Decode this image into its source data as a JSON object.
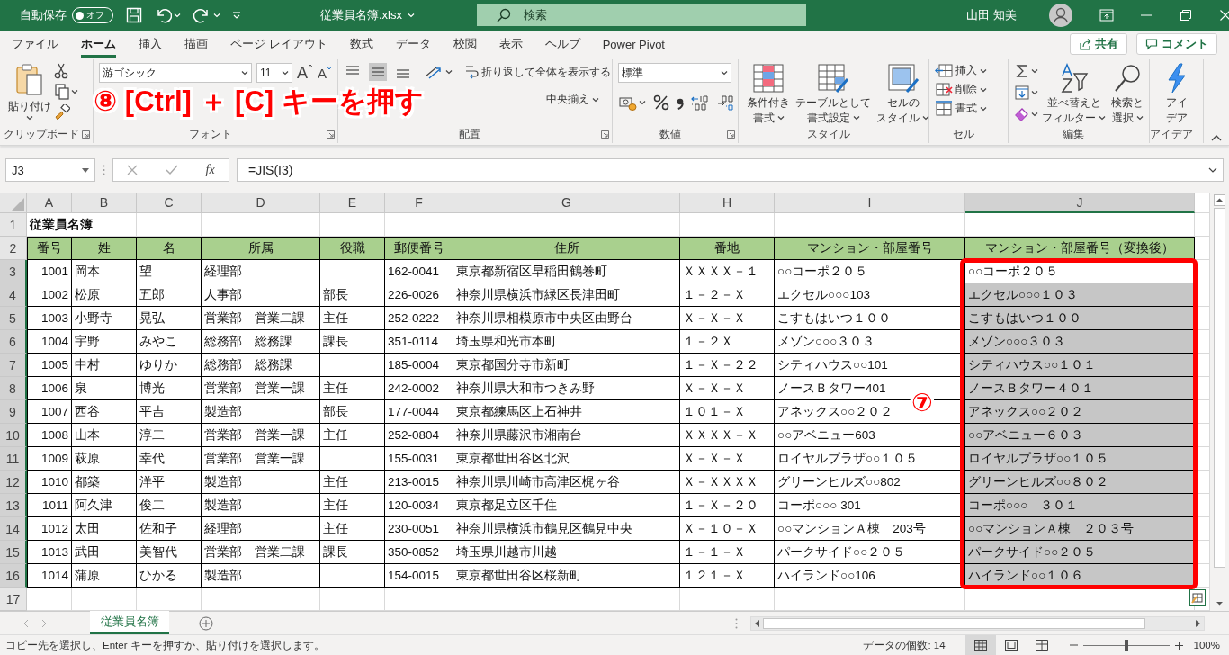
{
  "title_bar": {
    "autosave_label": "自動保存",
    "autosave_toggle": {
      "label": "オフ",
      "on": false
    },
    "file_name": "従業員名簿.xlsx",
    "search_placeholder": "検索",
    "user_name": "山田 知美"
  },
  "menu_tabs": [
    {
      "label": "ファイル",
      "selected": false
    },
    {
      "label": "ホーム",
      "selected": true
    },
    {
      "label": "挿入",
      "selected": false
    },
    {
      "label": "描画",
      "selected": false
    },
    {
      "label": "ページ レイアウト",
      "selected": false
    },
    {
      "label": "数式",
      "selected": false
    },
    {
      "label": "データ",
      "selected": false
    },
    {
      "label": "校閲",
      "selected": false
    },
    {
      "label": "表示",
      "selected": false
    },
    {
      "label": "ヘルプ",
      "selected": false
    },
    {
      "label": "Power Pivot",
      "selected": false
    }
  ],
  "actions": [
    {
      "label": "共有",
      "kind": "share"
    },
    {
      "label": "コメント",
      "kind": "comment"
    }
  ],
  "ribbon": {
    "clipboard": {
      "paste": "貼り付け",
      "label": "クリップボード"
    },
    "font": {
      "font_name": "游ゴシック",
      "font_size": "11",
      "grow": "A",
      "shrink": "A",
      "label": "フォント"
    },
    "alignment": {
      "wrap_text": "折り返して全体を表示する",
      "merge_center": "中央揃え",
      "label": "配置"
    },
    "number": {
      "format": "標準",
      "label": "数値"
    },
    "styles": {
      "buttons": [
        {
          "lines": [
            "条件付き",
            "書式"
          ],
          "kind": "conditional"
        },
        {
          "lines": [
            "テーブルとして",
            "書式設定"
          ],
          "kind": "table"
        },
        {
          "lines": [
            "セルの",
            "スタイル"
          ],
          "kind": "cellstyle"
        }
      ],
      "label": "スタイル"
    },
    "cells": {
      "buttons": [
        {
          "label": "挿入",
          "kind": "insert"
        },
        {
          "label": "削除",
          "kind": "delete"
        },
        {
          "label": "書式",
          "kind": "format"
        }
      ],
      "label": "セル"
    },
    "editing": {
      "buttons": [
        {
          "lines": [
            "並べ替えと",
            "フィルター"
          ],
          "kind": "sort"
        },
        {
          "lines": [
            "検索と",
            "選択"
          ],
          "kind": "find"
        }
      ],
      "label": "編集"
    },
    "ideas": {
      "lines": [
        "アイ",
        "デア"
      ],
      "label": "アイデア"
    }
  },
  "formula_bar": {
    "name_box": "J3",
    "function_label": "fx",
    "formula": "=JIS(I3)"
  },
  "sheet": {
    "columns": [
      {
        "letter": "A",
        "selected": false
      },
      {
        "letter": "B",
        "selected": false
      },
      {
        "letter": "C",
        "selected": false
      },
      {
        "letter": "D",
        "selected": false
      },
      {
        "letter": "E",
        "selected": false
      },
      {
        "letter": "F",
        "selected": false
      },
      {
        "letter": "G",
        "selected": false
      },
      {
        "letter": "H",
        "selected": false
      },
      {
        "letter": "I",
        "selected": false
      },
      {
        "letter": "J",
        "selected": true
      }
    ],
    "row_numbers": [
      "1",
      "2",
      "3",
      "4",
      "5",
      "6",
      "7",
      "8",
      "9",
      "10",
      "11",
      "12",
      "13",
      "14",
      "15",
      "16",
      "17"
    ],
    "title": "従業員名簿",
    "headers": [
      "番号",
      "姓",
      "名",
      "所属",
      "役職",
      "郵便番号",
      "住所",
      "番地",
      "マンション・部屋番号",
      "マンション・部屋番号（変換後）"
    ],
    "rows": [
      {
        "number": "1001",
        "last_name": "岡本",
        "first_name": "望",
        "department": "経理部",
        "postal_code": "162-0041",
        "address": "東京都新宿区早稲田鶴巻町",
        "block": "ＸＸＸＸ－１",
        "building": "○○コーポ２０５",
        "building_converted": "○○コーポ２０５",
        "selected": true,
        "active": true
      },
      {
        "number": "1002",
        "last_name": "松原",
        "first_name": "五郎",
        "department": "人事部",
        "position": "部長",
        "postal_code": "226-0026",
        "address": "神奈川県横浜市緑区長津田町",
        "block": "１－２－Ｘ",
        "building": "エクセル○○○103",
        "building_converted": "エクセル○○○１０３",
        "selected": true,
        "active": false
      },
      {
        "number": "1003",
        "last_name": "小野寺",
        "first_name": "晃弘",
        "department": "営業部　営業二課",
        "position": "主任",
        "postal_code": "252-0222",
        "address": "神奈川県相模原市中央区由野台",
        "block": "Ｘ－Ｘ－Ｘ",
        "building": "こすもはいつ１００",
        "building_converted": "こすもはいつ１００",
        "selected": true,
        "active": false
      },
      {
        "number": "1004",
        "last_name": "宇野",
        "first_name": "みやこ",
        "department": "総務部　総務課",
        "position": "課長",
        "postal_code": "351-0114",
        "address": "埼玉県和光市本町",
        "block": "１－２Ｘ",
        "building": "メゾン○○○３０３",
        "building_converted": "メゾン○○○３０３",
        "selected": true,
        "active": false
      },
      {
        "number": "1005",
        "last_name": "中村",
        "first_name": "ゆりか",
        "department": "総務部　総務課",
        "postal_code": "185-0004",
        "address": "東京都国分寺市新町",
        "block": "１－Ｘ－２２",
        "building": "シティハウス○○101",
        "building_converted": "シティハウス○○１０１",
        "selected": true,
        "active": false
      },
      {
        "number": "1006",
        "last_name": "泉",
        "first_name": "博光",
        "department": "営業部　営業一課",
        "position": "主任",
        "postal_code": "242-0002",
        "address": "神奈川県大和市つきみ野",
        "block": "Ｘ－Ｘ－Ｘ",
        "building": "ノースＢタワー401",
        "building_converted": "ノースＢタワー４０１",
        "selected": true,
        "active": false
      },
      {
        "number": "1007",
        "last_name": "西谷",
        "first_name": "平吉",
        "department": "製造部",
        "position": "部長",
        "postal_code": "177-0044",
        "address": "東京都練馬区上石神井",
        "block": "１０１－Ｘ",
        "building": "アネックス○○２０２",
        "building_converted": "アネックス○○２０２",
        "selected": true,
        "active": false
      },
      {
        "number": "1008",
        "last_name": "山本",
        "first_name": "淳二",
        "department": "営業部　営業一課",
        "position": "主任",
        "postal_code": "252-0804",
        "address": "神奈川県藤沢市湘南台",
        "block": "ＸＸＸＸ－Ｘ",
        "building": "○○アベニュー603",
        "building_converted": "○○アベニュー６０３",
        "selected": true,
        "active": false
      },
      {
        "number": "1009",
        "last_name": "萩原",
        "first_name": "幸代",
        "department": "営業部　営業一課",
        "postal_code": "155-0031",
        "address": "東京都世田谷区北沢",
        "block": "Ｘ－Ｘ－Ｘ",
        "building": "ロイヤルプラザ○○１０５",
        "building_converted": "ロイヤルプラザ○○１０５",
        "selected": true,
        "active": false
      },
      {
        "number": "1010",
        "last_name": "都築",
        "first_name": "洋平",
        "department": "製造部",
        "position": "主任",
        "postal_code": "213-0015",
        "address": "神奈川県川崎市高津区梶ヶ谷",
        "block": "Ｘ－ＸＸＸＸ",
        "building": "グリーンヒルズ○○802",
        "building_converted": "グリーンヒルズ○○８０２",
        "selected": true,
        "active": false
      },
      {
        "number": "1011",
        "last_name": "阿久津",
        "first_name": "俊二",
        "department": "製造部",
        "position": "主任",
        "postal_code": "120-0034",
        "address": "東京都足立区千住",
        "block": "１－Ｘ－２０",
        "building": "コーポ○○○ 301",
        "building_converted": "コーポ○○○　３０１",
        "selected": true,
        "active": false
      },
      {
        "number": "1012",
        "last_name": "太田",
        "first_name": "佐和子",
        "department": "経理部",
        "position": "主任",
        "postal_code": "230-0051",
        "address": "神奈川県横浜市鶴見区鶴見中央",
        "block": "Ｘ－１０－Ｘ",
        "building": "○○マンションＡ棟　203号",
        "building_converted": "○○マンションＡ棟　２０３号",
        "selected": true,
        "active": false
      },
      {
        "number": "1013",
        "last_name": "武田",
        "first_name": "美智代",
        "department": "営業部　営業二課",
        "position": "課長",
        "postal_code": "350-0852",
        "address": "埼玉県川越市川越",
        "block": "１－１－Ｘ",
        "building": "パークサイド○○２０５",
        "building_converted": "パークサイド○○２０５",
        "selected": true,
        "active": false
      },
      {
        "number": "1014",
        "last_name": "蒲原",
        "first_name": "ひかる",
        "department": "製造部",
        "postal_code": "154-0015",
        "address": "東京都世田谷区桜新町",
        "block": "１２１－Ｘ",
        "building": "ハイランド○○106",
        "building_converted": "ハイランド○○１０６",
        "selected": true,
        "active": false
      }
    ]
  },
  "sheet_tabs": [
    {
      "label": "従業員名簿",
      "selected": true
    }
  ],
  "status_bar": {
    "message": "コピー先を選択し、Enter キーを押すか、貼り付けを選択します。",
    "count": "データの個数: 14",
    "zoom_slider": {
      "level": 0.5
    },
    "zoom": "100%"
  },
  "annotations": [
    {
      "kind": "instruction",
      "text": "⑧ [Ctrl] ＋ [C] キーを押す"
    },
    {
      "kind": "step",
      "text": "⑦"
    }
  ]
}
